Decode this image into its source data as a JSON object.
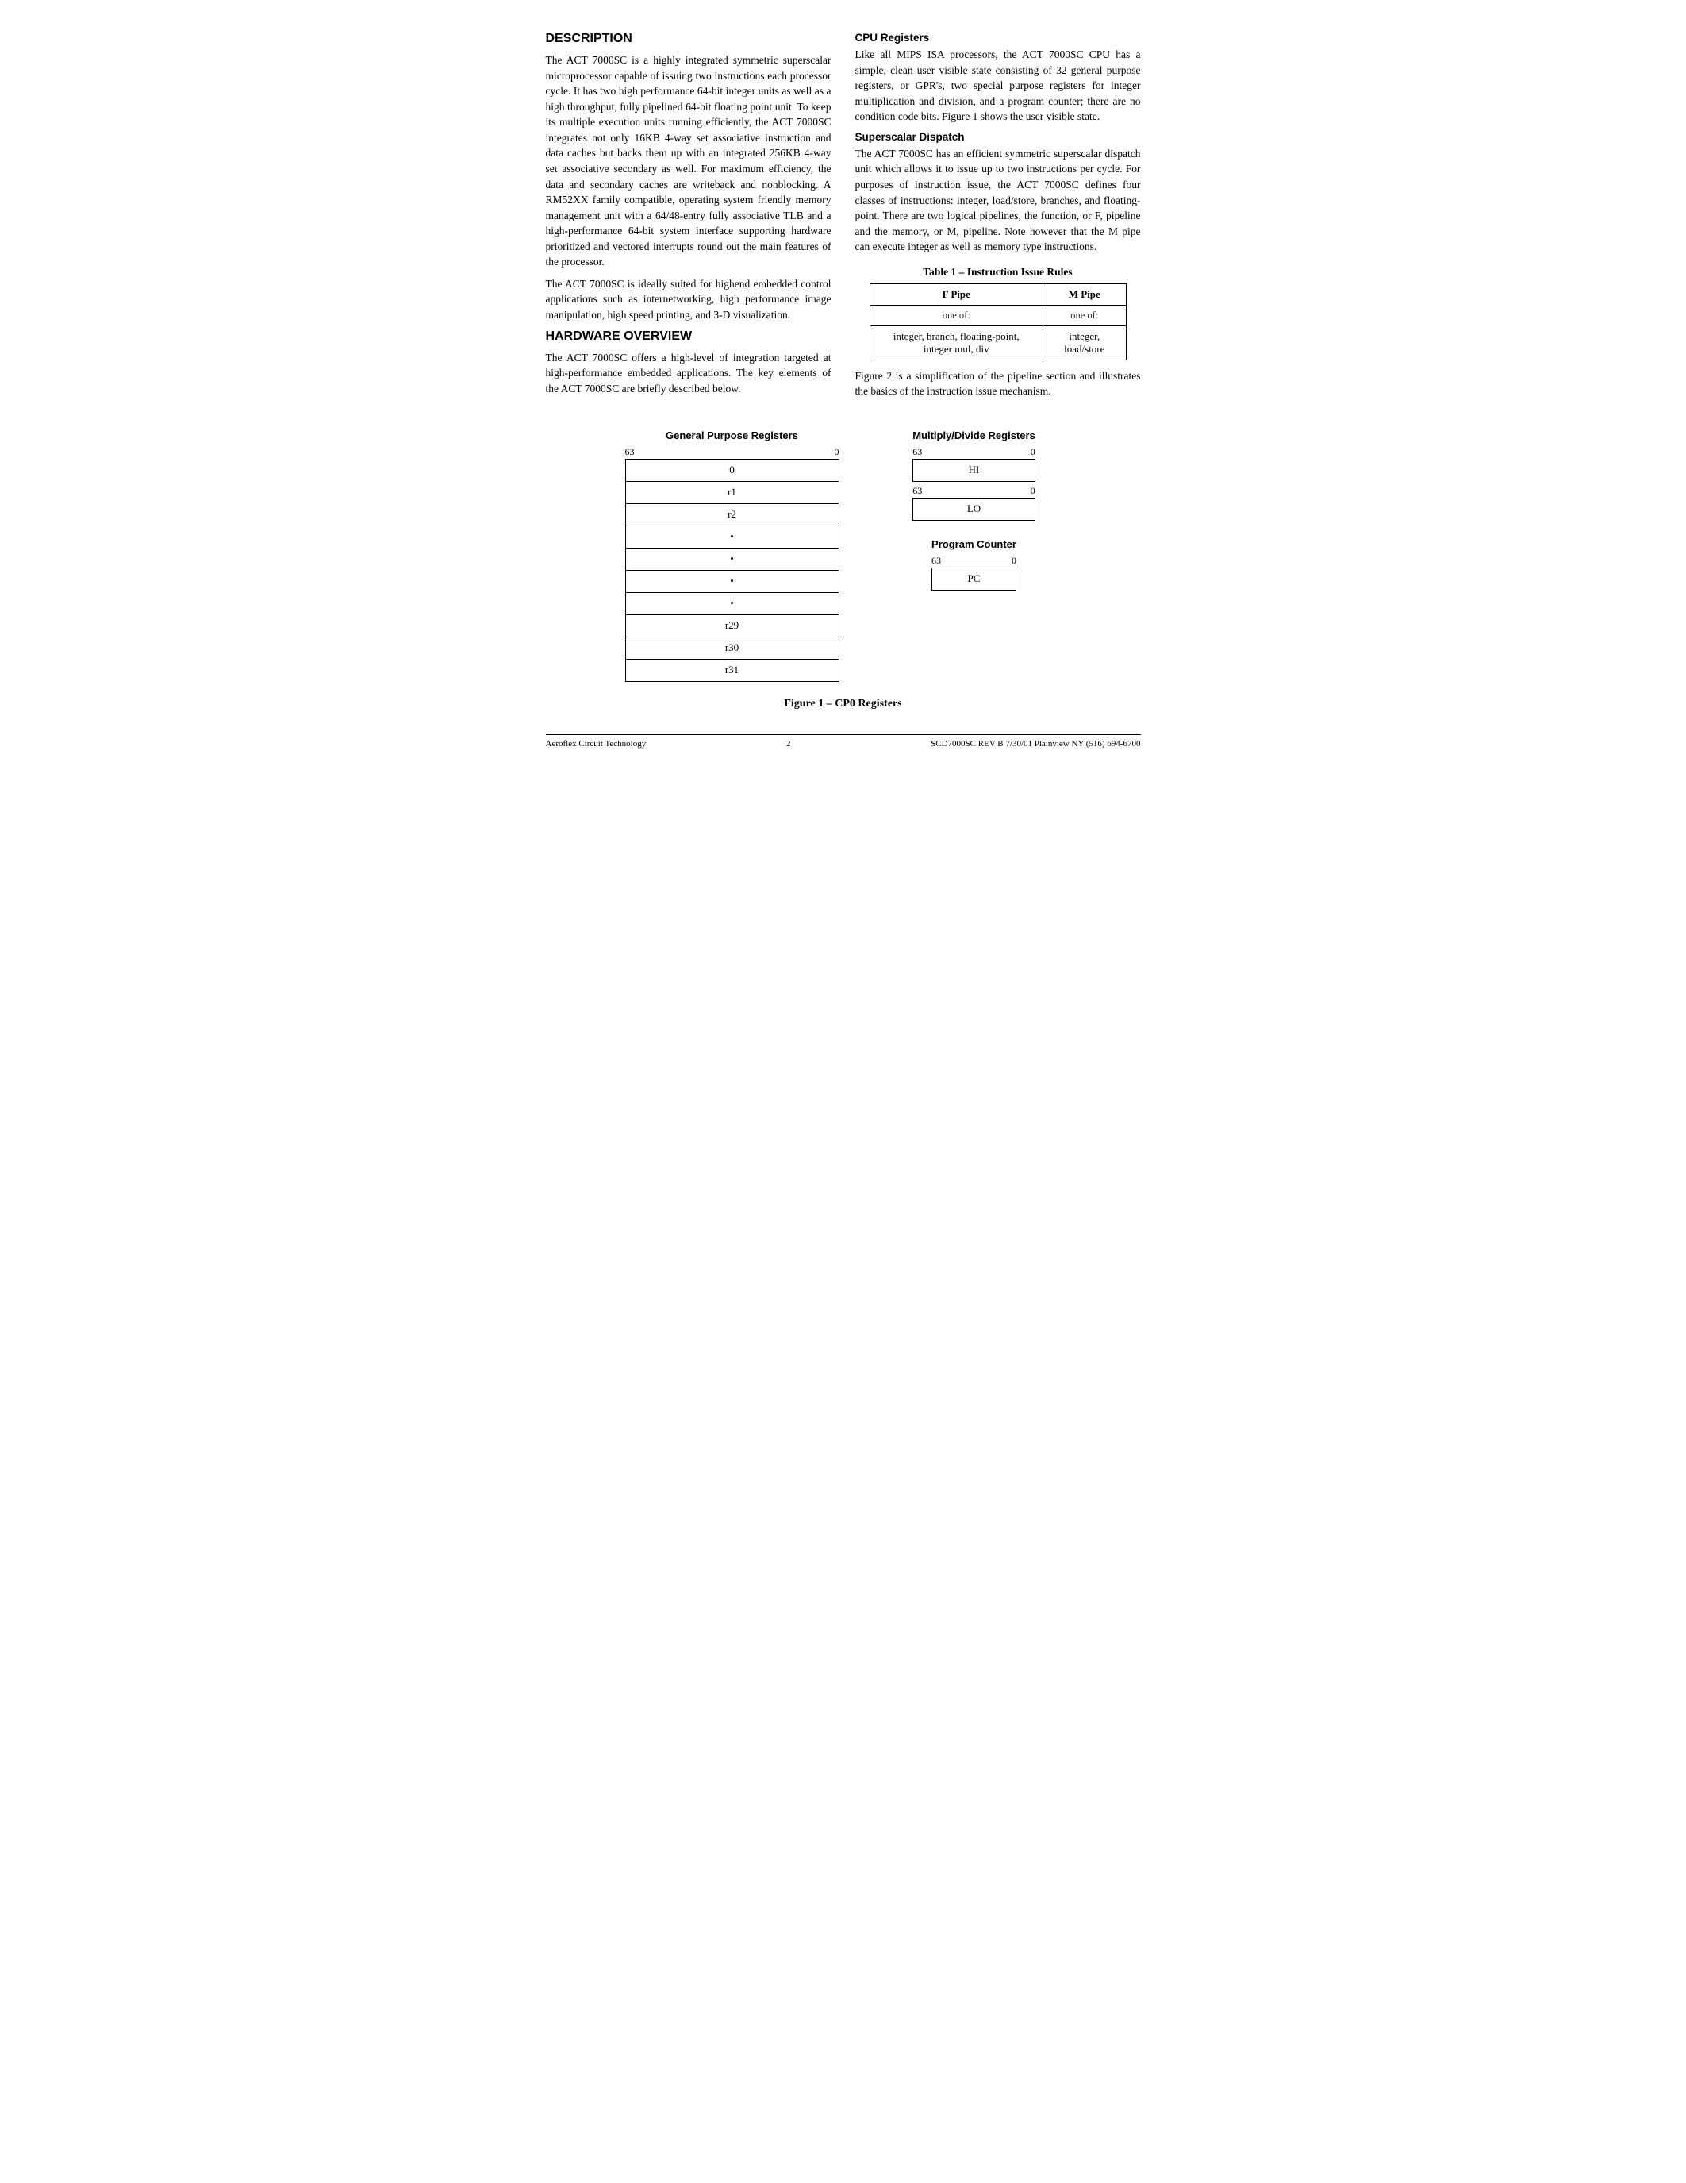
{
  "page": {
    "page_number": "2"
  },
  "description": {
    "title": "DESCRIPTION",
    "paragraphs": [
      "The ACT 7000SC is a highly integrated symmetric superscalar microprocessor capable of issuing two instructions each processor cycle. It has two high performance 64-bit integer units as well as a high throughput, fully pipelined 64-bit floating point unit. To keep its multiple execution units running efficiently, the ACT 7000SC integrates not only 16KB 4-way set associative instruction and data caches but backs them up with an integrated 256KB 4-way set associative secondary as well. For maximum efficiency, the data and secondary caches are writeback and nonblocking. A RM52XX family compatible, operating system friendly memory management unit with a 64/48-entry fully associative TLB and a high-performance 64-bit system interface supporting hardware prioritized and vectored interrupts round out the main features of the processor.",
      "The ACT 7000SC is ideally suited for highend embedded control applications such as internetworking, high performance image manipulation, high speed printing, and 3-D visualization."
    ]
  },
  "hardware_overview": {
    "title": "HARDWARE OVERVIEW",
    "paragraph": "The ACT 7000SC offers a high-level of integration targeted at high-performance embedded applications. The key elements of the ACT 7000SC are briefly described below."
  },
  "cpu_registers": {
    "title": "CPU Registers",
    "paragraph": "Like all MIPS ISA processors, the ACT 7000SC CPU has a simple, clean user visible state consisting of 32 general purpose registers, or GPR's, two special purpose registers for integer multiplication and division, and a program counter; there are no condition code bits. Figure 1 shows the user visible state."
  },
  "superscalar_dispatch": {
    "title": "Superscalar Dispatch",
    "paragraph": "The ACT 7000SC has an efficient symmetric superscalar dispatch unit which allows it to issue up to two instructions per cycle. For purposes of instruction issue, the ACT 7000SC defines four classes of instructions: integer, load/store, branches, and floating-point. There are two logical pipelines, the function, or F, pipeline and the memory, or M, pipeline. Note however that the M pipe can execute integer as well as memory type instructions."
  },
  "table": {
    "title": "Table 1 – Instruction Issue Rules",
    "col1_header": "F Pipe",
    "col2_header": "M Pipe",
    "row1_col1": "one of:",
    "row1_col2": "one of:",
    "row2_col1": "integer, branch, floating-point, integer mul, div",
    "row2_col2": "integer, load/store"
  },
  "table_note": "Figure 2 is a simplification of the pipeline section and illustrates the basics of the instruction issue mechanism.",
  "gpr": {
    "label": "General Purpose Registers",
    "bit_high": "63",
    "bit_low": "0",
    "rows": [
      "0",
      "r1",
      "r2",
      "•",
      "•",
      "•",
      "•",
      "r29",
      "r30",
      "r31"
    ]
  },
  "multiply_divide": {
    "label": "Multiply/Divide Registers",
    "hi_bit_high": "63",
    "hi_bit_low": "0",
    "hi_label": "HI",
    "lo_bit_high": "63",
    "lo_bit_low": "0",
    "lo_label": "LO"
  },
  "program_counter": {
    "label": "Program Counter",
    "bit_high": "63",
    "bit_low": "0",
    "pc_label": "PC"
  },
  "figure_caption": "Figure 1 – CP0 Registers",
  "footer": {
    "left": "Aeroflex Circuit Technology",
    "center": "2",
    "right": "SCD7000SC REV B  7/30/01  Plainview NY (516) 694-6700"
  }
}
